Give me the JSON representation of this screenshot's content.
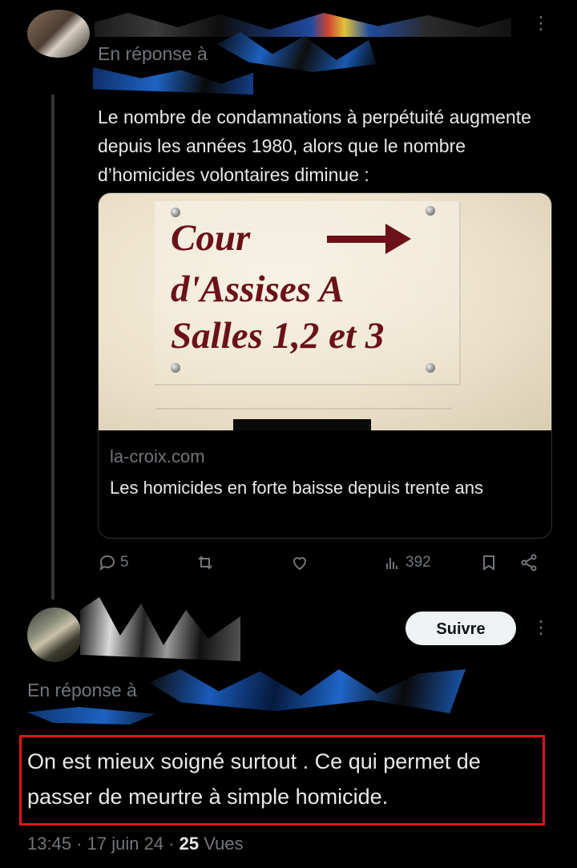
{
  "parent_tweet": {
    "reply_prefix": "En réponse à",
    "text": "Le nombre de condamnations à perpétuité augmente depuis les années 1980, alors que le nombre d’homicides volontaires diminue :",
    "card": {
      "image_text": {
        "line1": "Cour",
        "line2": "d'Assises A",
        "line3": "Salles 1,2 et 3"
      },
      "domain": "la-croix.com",
      "title": "Les homicides en forte baisse depuis trente ans"
    },
    "actions": {
      "replies": "5",
      "views": "392"
    },
    "more_glyph": "⋮"
  },
  "main_tweet": {
    "follow_label": "Suivre",
    "reply_prefix": "En réponse à",
    "text": "On est mieux soigné surtout . Ce qui permet de passer de meurtre à simple homicide.",
    "time": "13:45",
    "date": "17 juin 24",
    "views_count": "25",
    "views_label": "Vues",
    "separator": "·",
    "more_glyph": "⋮"
  },
  "colors": {
    "background": "#000000",
    "text": "#e7e9ea",
    "muted": "#71767b",
    "highlight_border": "#e0141c",
    "sign_text": "#6b1117"
  },
  "icons": [
    "reply-icon",
    "retweet-icon",
    "like-icon",
    "views-icon",
    "bookmark-icon",
    "share-icon",
    "more-icon"
  ]
}
